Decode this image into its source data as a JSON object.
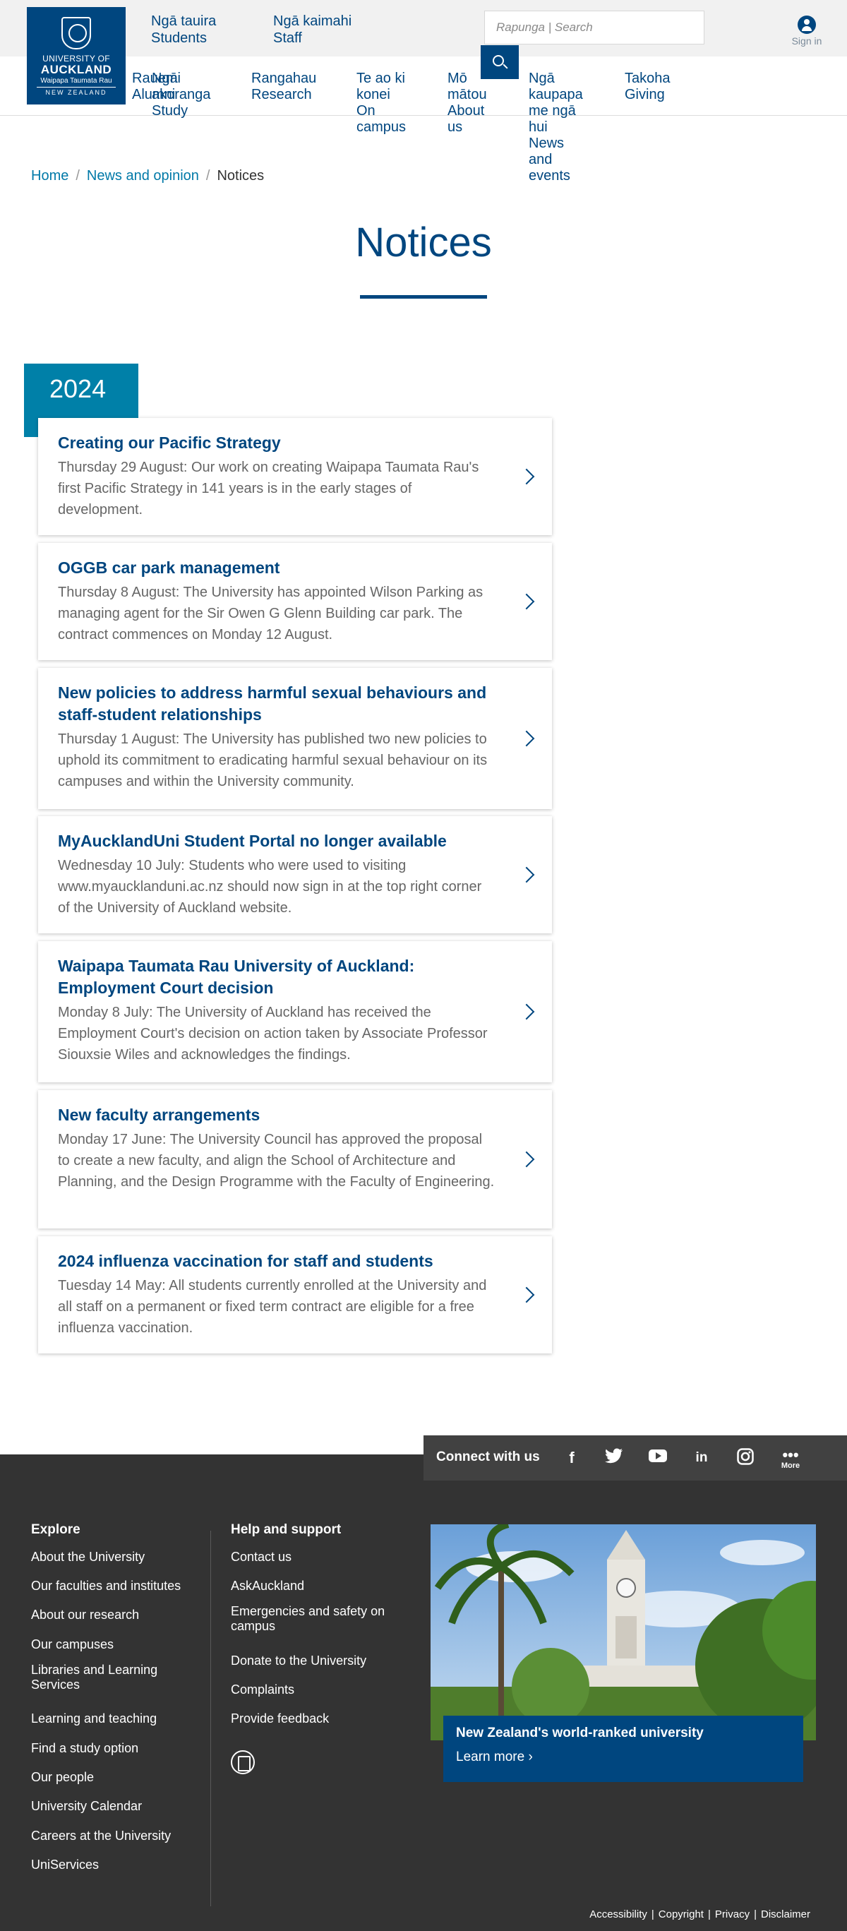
{
  "header": {
    "logo": {
      "line1": "UNIVERSITY OF",
      "line2": "AUCKLAND",
      "line3": "Waipapa Taumata Rau",
      "line4": "NEW ZEALAND"
    },
    "top_links": [
      {
        "maori": "Ngā tauira",
        "english": "Students"
      },
      {
        "maori": "Ngā kaimahi",
        "english": "Staff"
      }
    ],
    "search_placeholder": "Rapunga | Search",
    "sign_in": "Sign in"
  },
  "nav": [
    {
      "lines": [
        "Rauemi",
        "Alumni"
      ]
    },
    {
      "lines": [
        "Ngā",
        "akoranga",
        "Study"
      ]
    },
    {
      "lines": [
        "Rangahau",
        "Research"
      ]
    },
    {
      "lines": [
        "Te ao ki",
        "konei",
        "On",
        "campus"
      ]
    },
    {
      "lines": [
        "Mō",
        "mātou",
        "About",
        "us"
      ]
    },
    {
      "lines": [
        "Ngā",
        "kaupapa",
        "me ngā",
        "hui",
        "News",
        "and",
        "events"
      ]
    },
    {
      "lines": [
        "Takoha",
        "Giving"
      ]
    }
  ],
  "breadcrumb": {
    "home": "Home",
    "news": "News and opinion",
    "current": "Notices"
  },
  "page_title": "Notices",
  "year": "2024",
  "notices": [
    {
      "title": "Creating our Pacific Strategy",
      "summary": "Thursday 29 August: Our work on creating Waipapa Taumata Rau's first Pacific Strategy in 141 years is in the early stages of development."
    },
    {
      "title": "OGGB car park management",
      "summary": "Thursday 8 August: The University has appointed Wilson Parking as managing agent for the Sir Owen G Glenn Building car park. The contract commences on Monday 12 August."
    },
    {
      "title": "New policies to address harmful sexual behaviours and staff-student relationships",
      "summary": "Thursday 1 August: The University has published two new policies to uphold its commitment to eradicating harmful sexual behaviour on its campuses and within the University community."
    },
    {
      "title": "MyAucklandUni Student Portal no longer available",
      "summary": "Wednesday 10 July: Students who were used to visiting www.myaucklanduni.ac.nz should now sign in at the top right corner of the University of Auckland website."
    },
    {
      "title": "Waipapa Taumata Rau University of Auckland: Employment Court decision",
      "summary": "Monday 8 July: The University of Auckland has received the Employment Court's decision on action taken by Associate Professor Siouxsie Wiles and acknowledges the findings."
    },
    {
      "title": "New faculty arrangements",
      "summary": "Monday 17 June: The University Council has approved the proposal to create a new faculty, and align the School of Architecture and Planning, and the Design Programme with the Faculty of Engineering."
    },
    {
      "title": "2024 influenza vaccination for staff and students",
      "summary": "Tuesday 14 May: All students currently enrolled at the University and all staff on a permanent or fixed term contract are eligible for a free influenza vaccination."
    }
  ],
  "connect": {
    "label": "Connect with us",
    "social": [
      "f",
      "t",
      "yt",
      "in",
      "ig"
    ],
    "more": "More"
  },
  "footer": {
    "explore_heading": "Explore",
    "explore_links": [
      "About the University",
      "Our faculties and institutes",
      "About our research",
      "Our campuses",
      "Libraries and Learning Services",
      "Learning and teaching",
      "Find a study option",
      "Our people",
      "University Calendar",
      "Careers at the University",
      "UniServices"
    ],
    "help_heading": "Help and support",
    "help_links": [
      "Contact us",
      "AskAuckland",
      "Emergencies and safety on campus",
      "Donate to the University",
      "Complaints",
      "Provide feedback"
    ],
    "promo_title": "New Zealand's world-ranked university",
    "promo_link": "Learn more",
    "legal": [
      "Accessibility",
      "Copyright",
      "Privacy",
      "Disclaimer"
    ]
  },
  "colors": {
    "brand_blue": "#00467f",
    "accent_teal": "#0080a8",
    "footer_bg": "#333333"
  }
}
